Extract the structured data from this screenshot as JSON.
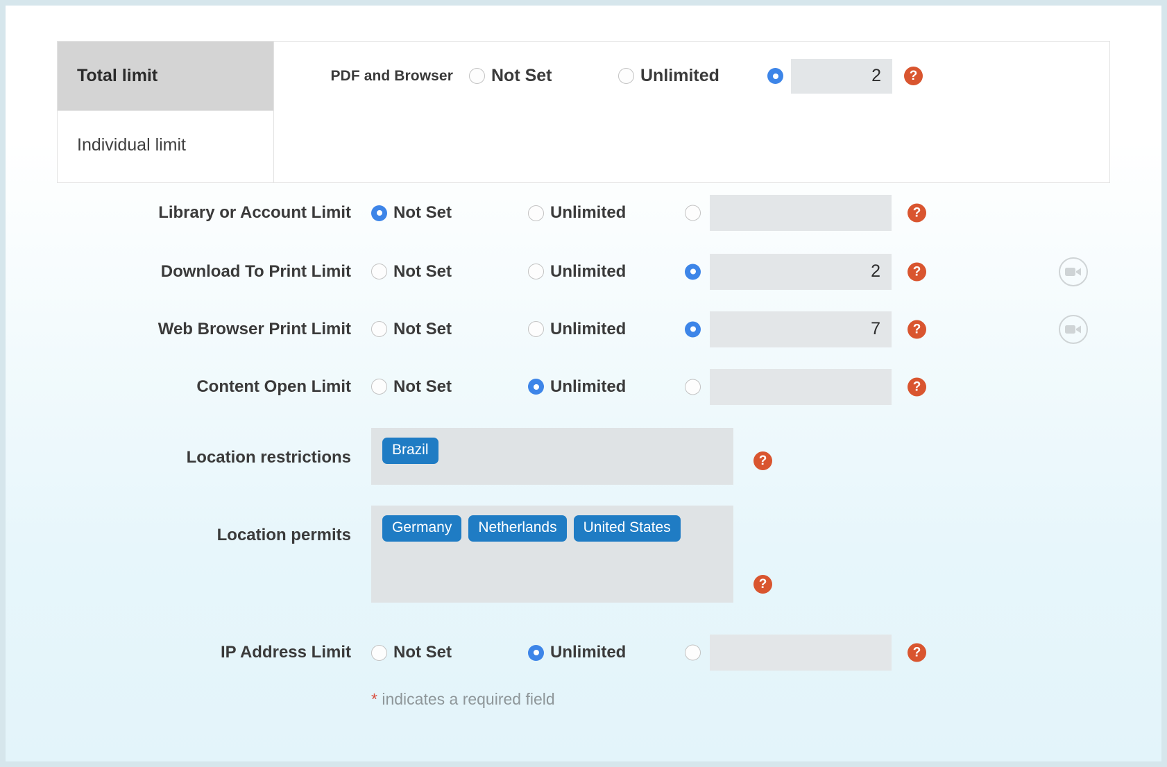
{
  "theme": {
    "accent_blue": "#3d85e8",
    "tag_blue": "#1f7cc4",
    "help_orange": "#d9552f",
    "required_red": "#d84a3a",
    "input_grey": "#e3e6e8",
    "tab_active_grey": "#d4d4d4"
  },
  "tabs": [
    {
      "label": "Total limit",
      "active": true
    },
    {
      "label": "Individual limit",
      "active": false
    }
  ],
  "total_limit_panel": {
    "label": "PDF and Browser",
    "options": [
      {
        "label": "Not Set",
        "selected": false
      },
      {
        "label": "Unlimited",
        "selected": false
      }
    ],
    "value_option_selected": true,
    "value": "2",
    "help_icon": "help-icon",
    "help_glyph": "?"
  },
  "form_rows": [
    {
      "label": "Library or Account Limit",
      "options": [
        {
          "label": "Not Set",
          "selected": true
        },
        {
          "label": "Unlimited",
          "selected": false
        }
      ],
      "value_option_selected": false,
      "value": "",
      "has_video_icon": false
    },
    {
      "label": "Download To Print Limit",
      "options": [
        {
          "label": "Not Set",
          "selected": false
        },
        {
          "label": "Unlimited",
          "selected": false
        }
      ],
      "value_option_selected": true,
      "value": "2",
      "has_video_icon": true
    },
    {
      "label": "Web Browser Print Limit",
      "options": [
        {
          "label": "Not Set",
          "selected": false
        },
        {
          "label": "Unlimited",
          "selected": false
        }
      ],
      "value_option_selected": true,
      "value": "7",
      "has_video_icon": true
    },
    {
      "label": "Content Open Limit",
      "options": [
        {
          "label": "Not Set",
          "selected": false
        },
        {
          "label": "Unlimited",
          "selected": true
        }
      ],
      "value_option_selected": false,
      "value": "",
      "has_video_icon": false
    }
  ],
  "location_restrictions": {
    "label": "Location restrictions",
    "tags": [
      "Brazil"
    ]
  },
  "location_permits": {
    "label": "Location permits",
    "tags": [
      "Germany",
      "Netherlands",
      "United States"
    ]
  },
  "ip_address_limit": {
    "label": "IP Address Limit",
    "options": [
      {
        "label": "Not Set",
        "selected": false
      },
      {
        "label": "Unlimited",
        "selected": true
      }
    ],
    "value_option_selected": false,
    "value": "",
    "has_video_icon": false
  },
  "footer": {
    "required_star": "*",
    "required_note": "indicates a required field"
  },
  "icons": {
    "help": "?",
    "video": "video-camera-icon"
  }
}
